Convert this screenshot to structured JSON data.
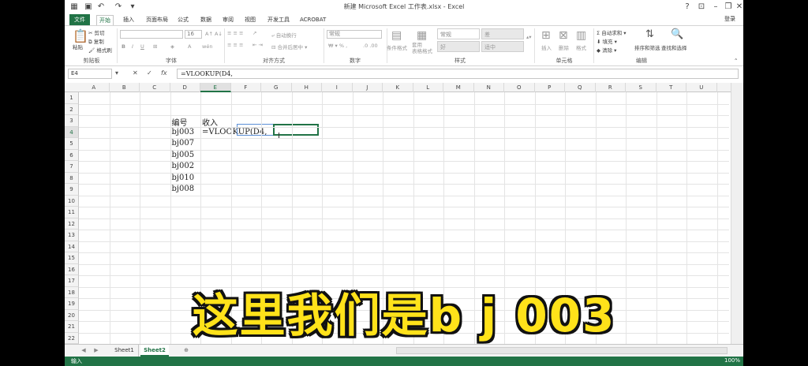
{
  "window": {
    "title": "新建 Microsoft Excel 工作表.xlsx - Excel",
    "controls": [
      "?",
      "⊡",
      "–",
      "❐",
      "✕"
    ]
  },
  "tabs": [
    "文件",
    "开始",
    "插入",
    "页面布局",
    "公式",
    "数据",
    "审阅",
    "视图",
    "开发工具",
    "ACROBAT"
  ],
  "login": "登录",
  "ribbon": {
    "clipboard": {
      "label": "剪贴板",
      "paste": "粘贴",
      "cut": "剪切",
      "copy": "复制",
      "format_painter": "格式刷"
    },
    "font": {
      "label": "字体",
      "size": "16"
    },
    "alignment": {
      "label": "对齐方式",
      "wrap": "自动换行",
      "merge": "合并后居中"
    },
    "number": {
      "label": "数字",
      "format": "常规"
    },
    "styles": {
      "label": "样式",
      "conditional": "条件格式",
      "table": "套用\n表格格式",
      "normal": "常规",
      "bad": "差",
      "good": "好",
      "neutral": "适中"
    },
    "cells": {
      "label": "单元格",
      "insert": "插入",
      "delete": "删除",
      "format": "格式"
    },
    "editing": {
      "label": "编辑",
      "autosum": "自动求和",
      "fill": "填充",
      "clear": "清除",
      "sort": "排序和筛选",
      "find": "查找和选择"
    }
  },
  "formula_bar": {
    "name_box": "E4",
    "formula": "=VLOOKUP(D4,"
  },
  "columns": [
    "A",
    "B",
    "C",
    "D",
    "E",
    "F",
    "G",
    "H",
    "I",
    "J",
    "K",
    "L",
    "M",
    "N",
    "O",
    "P",
    "Q",
    "R",
    "S",
    "T",
    "U"
  ],
  "rows": [
    "1",
    "2",
    "3",
    "4",
    "5",
    "6",
    "7",
    "8",
    "9",
    "10",
    "11",
    "12",
    "13",
    "14",
    "15",
    "16",
    "17",
    "18",
    "19",
    "20",
    "21",
    "22"
  ],
  "cells": {
    "D3": "编号",
    "E3": "收入",
    "D4": "bj003",
    "E4": "=VLOOKUP(D4,",
    "D5": "bj007",
    "D6": "bj005",
    "D7": "bj002",
    "D8": "bj010",
    "D9": "bj008"
  },
  "sheets": [
    "Sheet1",
    "Sheet2"
  ],
  "status": {
    "mode": "输入",
    "zoom": "100%"
  },
  "caption": "这里我们是b j 003",
  "colors": {
    "excel_green": "#217346",
    "caption_yellow": "#ffe21a",
    "selection_blue": "#5b8fd6"
  }
}
